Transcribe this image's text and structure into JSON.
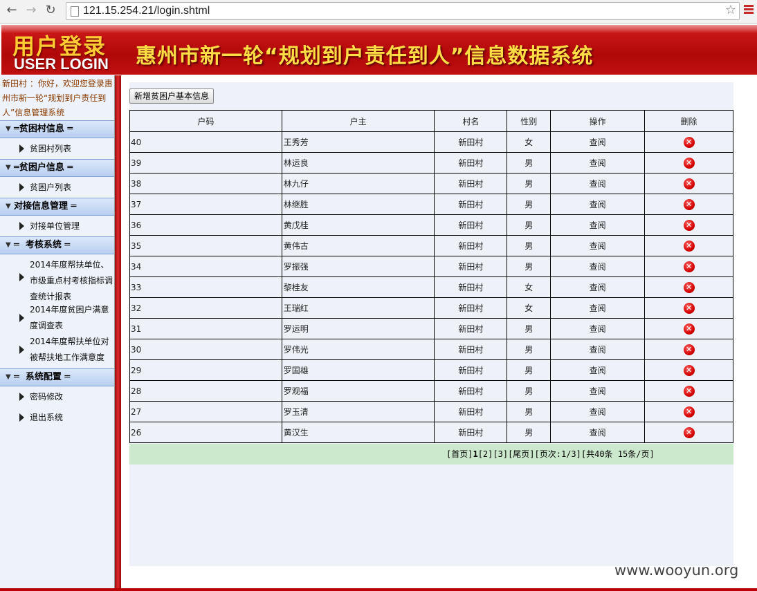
{
  "browser": {
    "url": "121.15.254.21/login.shtml"
  },
  "banner": {
    "login_cn": "用户登录",
    "login_en": "USER LOGIN",
    "title": "惠州市新一轮“规划到户责任到人”信息数据系统"
  },
  "sidebar": {
    "welcome": "新田村 ：你好，欢迎您登录惠州市新一轮“规划到户责任到人”信息管理系统",
    "sections": [
      {
        "title": "═贫困村信息 ═",
        "items": [
          "贫困村列表"
        ]
      },
      {
        "title": "═贫困户信息 ═",
        "items": [
          "贫困户列表"
        ]
      },
      {
        "title": "对接信息管理 ═",
        "items": [
          "对接单位管理"
        ]
      },
      {
        "title": "═  考核系统 ═",
        "items": [
          "2014年度帮扶单位、市级重点村考核指标调查统计报表",
          "2014年度贫困户满意度调查表",
          "2014年度帮扶单位对被帮扶地工作满意度"
        ]
      },
      {
        "title": "═  系统配置 ═",
        "items": [
          "密码修改",
          "退出系统"
        ]
      }
    ]
  },
  "main": {
    "add_button": "新增贫困户基本信息",
    "headers": [
      "户码",
      "户主",
      "村名",
      "性别",
      "操作",
      "删除"
    ],
    "view_label": "查阅",
    "rows": [
      {
        "code": "40",
        "owner": "王秀芳",
        "village": "新田村",
        "gender": "女"
      },
      {
        "code": "39",
        "owner": "林运良",
        "village": "新田村",
        "gender": "男"
      },
      {
        "code": "38",
        "owner": "林九仔",
        "village": "新田村",
        "gender": "男"
      },
      {
        "code": "37",
        "owner": "林继胜",
        "village": "新田村",
        "gender": "男"
      },
      {
        "code": "36",
        "owner": "黄戊桂",
        "village": "新田村",
        "gender": "男"
      },
      {
        "code": "35",
        "owner": "黄伟古",
        "village": "新田村",
        "gender": "男"
      },
      {
        "code": "34",
        "owner": "罗振强",
        "village": "新田村",
        "gender": "男"
      },
      {
        "code": "33",
        "owner": "黎桂友",
        "village": "新田村",
        "gender": "女"
      },
      {
        "code": "32",
        "owner": "王瑞红",
        "village": "新田村",
        "gender": "女"
      },
      {
        "code": "31",
        "owner": "罗运明",
        "village": "新田村",
        "gender": "男"
      },
      {
        "code": "30",
        "owner": "罗伟光",
        "village": "新田村",
        "gender": "男"
      },
      {
        "code": "29",
        "owner": "罗国雄",
        "village": "新田村",
        "gender": "男"
      },
      {
        "code": "28",
        "owner": "罗观福",
        "village": "新田村",
        "gender": "男"
      },
      {
        "code": "27",
        "owner": "罗玉清",
        "village": "新田村",
        "gender": "男"
      },
      {
        "code": "26",
        "owner": "黄汉生",
        "village": "新田村",
        "gender": "男"
      }
    ],
    "pager": {
      "first": "[首页]",
      "current": "1",
      "page2": "[2]",
      "page3": "[3]",
      "last": "[尾页]",
      "info": "[页次:1/3]",
      "total": "[共40条 15条/页]"
    }
  },
  "watermark": "www.wooyun.org",
  "icons": {
    "delete": "delete-x-icon",
    "collapse": "caret-down-icon",
    "expand": "triangle-right-icon"
  }
}
